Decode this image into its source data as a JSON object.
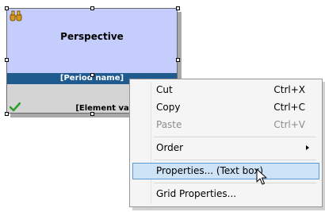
{
  "widget": {
    "title": "Perspective",
    "period_label": "[Period name]",
    "value_label": "[Element value]",
    "icons": {
      "top_left": "binoculars-icon",
      "bottom_left": "checkmark-icon"
    },
    "colors": {
      "top": "#c4cdfb",
      "bar": "#1f5b8f",
      "bottom": "#d4d4d4",
      "check": "#2e9e2e"
    }
  },
  "context_menu": {
    "items": [
      {
        "label": "Cut",
        "shortcut": "Ctrl+X",
        "enabled": true
      },
      {
        "label": "Copy",
        "shortcut": "Ctrl+C",
        "enabled": true
      },
      {
        "label": "Paste",
        "shortcut": "Ctrl+V",
        "enabled": false
      },
      {
        "label": "Order",
        "shortcut": "",
        "enabled": true,
        "submenu": true
      },
      {
        "label": "Properties... (Text box)",
        "shortcut": "",
        "enabled": true,
        "highlighted": true
      },
      {
        "label": "Grid Properties...",
        "shortcut": "",
        "enabled": true
      }
    ],
    "colors": {
      "highlight_fill": "#cfe3f7",
      "highlight_border": "#5b9ad6"
    }
  }
}
